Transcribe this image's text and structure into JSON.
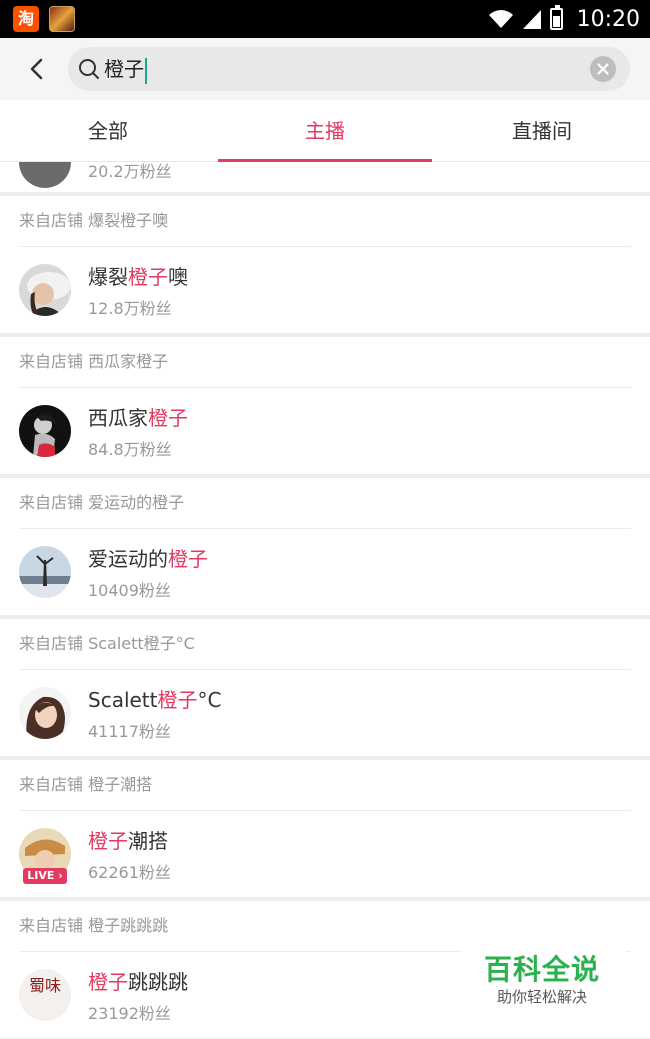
{
  "status_bar": {
    "time": "10:20",
    "taobao_icon_glyph": "淘"
  },
  "search": {
    "query": "橙子"
  },
  "tabs": [
    {
      "label": "全部",
      "active": false
    },
    {
      "label": "主播",
      "active": true
    },
    {
      "label": "直播间",
      "active": false
    }
  ],
  "partial_item": {
    "fans": "20.2万粉丝"
  },
  "results": [
    {
      "source": "来自店铺 爆裂橙子噢",
      "name_pre": "爆裂",
      "name_hl": "橙子",
      "name_post": "噢",
      "fans": "12.8万粉丝",
      "live": false
    },
    {
      "source": "来自店铺 西瓜家橙子",
      "name_pre": "西瓜家",
      "name_hl": "橙子",
      "name_post": "",
      "fans": "84.8万粉丝",
      "live": false
    },
    {
      "source": "来自店铺 爱运动的橙子",
      "name_pre": "爱运动的",
      "name_hl": "橙子",
      "name_post": "",
      "fans": "10409粉丝",
      "live": false
    },
    {
      "source": "来自店铺 Scalett橙子°C",
      "name_pre": "Scalett",
      "name_hl": "橙子",
      "name_post": "°C",
      "fans": "41117粉丝",
      "live": false
    },
    {
      "source": "来自店铺 橙子潮搭",
      "name_pre": "",
      "name_hl": "橙子",
      "name_post": "潮搭",
      "fans": "62261粉丝",
      "live": true,
      "live_label": "LIVE ›"
    },
    {
      "source": "来自店铺 橙子跳跳跳",
      "name_pre": "",
      "name_hl": "橙子",
      "name_post": "跳跳跳",
      "fans": "23192粉丝",
      "live": false
    }
  ],
  "avatar_logo_text": "蜀味",
  "watermark": {
    "title": "百科全说",
    "subtitle": "助你轻松解决"
  },
  "colors": {
    "accent": "#e23a61",
    "watermark_green": "#2bb24c"
  }
}
